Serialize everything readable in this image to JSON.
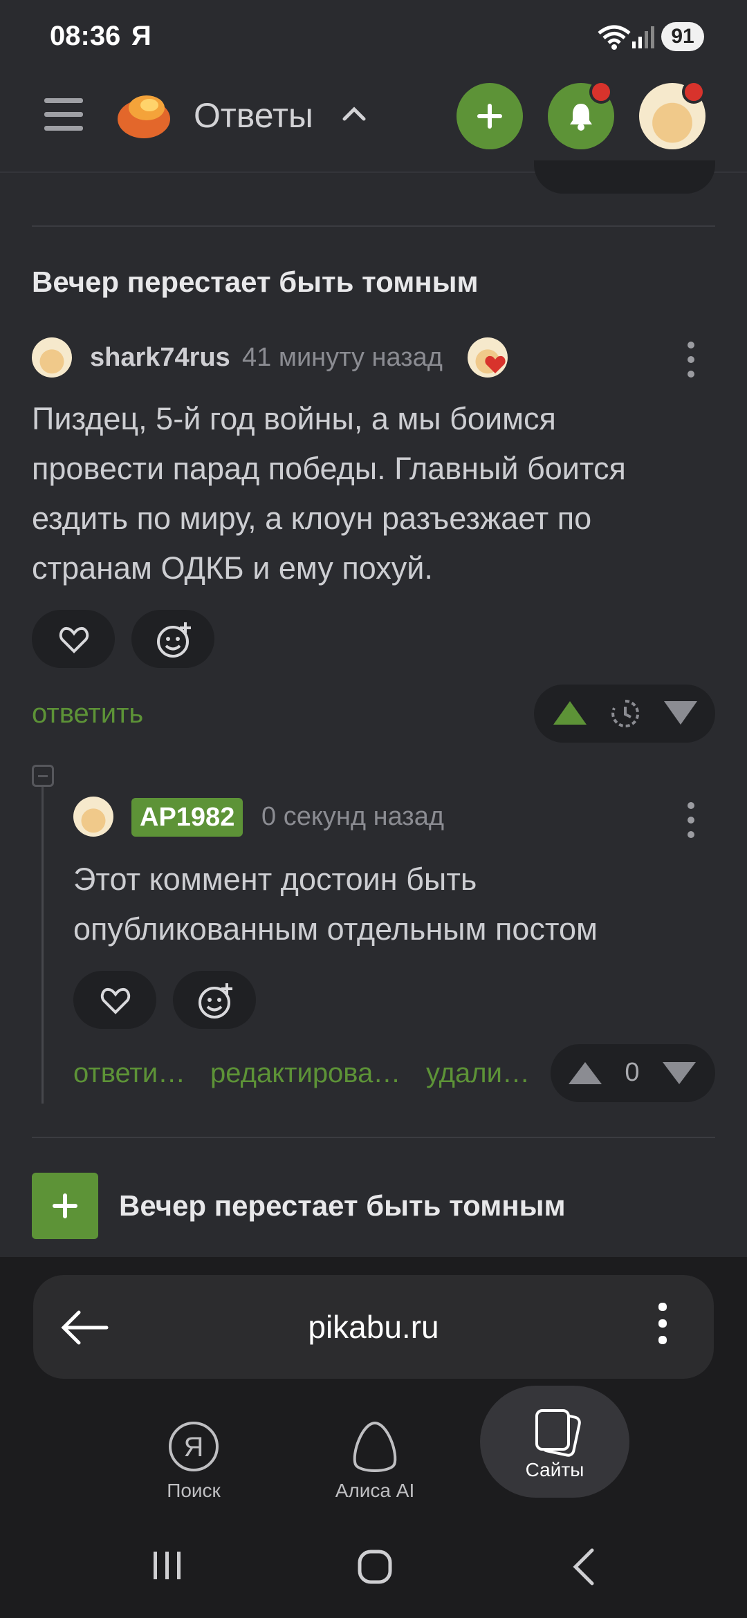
{
  "status": {
    "time": "08:36",
    "carrier": "Я",
    "battery": "91"
  },
  "header": {
    "title": "Ответы"
  },
  "section": {
    "heading": "Вечер перестает быть томным",
    "add_heading": "Вечер перестает быть томным"
  },
  "comment1": {
    "username": "shark74rus",
    "time": "41 минуту назад",
    "lines": [
      "Пиздец, 5-й год войны, а мы боимся",
      "провести парад победы. Главный боится",
      "ездить по миру, а клоун разъезжает по",
      "странам ОДКБ и ему похуй."
    ],
    "reply_label": "ответить"
  },
  "comment2": {
    "username": "AP1982",
    "time": "0 секунд назад",
    "lines": [
      "Этот коммент достоин быть",
      "опубликованным отдельным постом"
    ],
    "reply_label": "ответи…",
    "edit_label": "редактирова…",
    "delete_label": "удали…",
    "rating": "0"
  },
  "browser": {
    "url": "pikabu.ru",
    "nav": [
      {
        "label": "Поиск"
      },
      {
        "label": "Алиса AI"
      },
      {
        "label": "Сайты"
      }
    ]
  },
  "colors": {
    "accent": "#5d9337",
    "background": "#2a2b2f",
    "notification": "#d8332c"
  }
}
